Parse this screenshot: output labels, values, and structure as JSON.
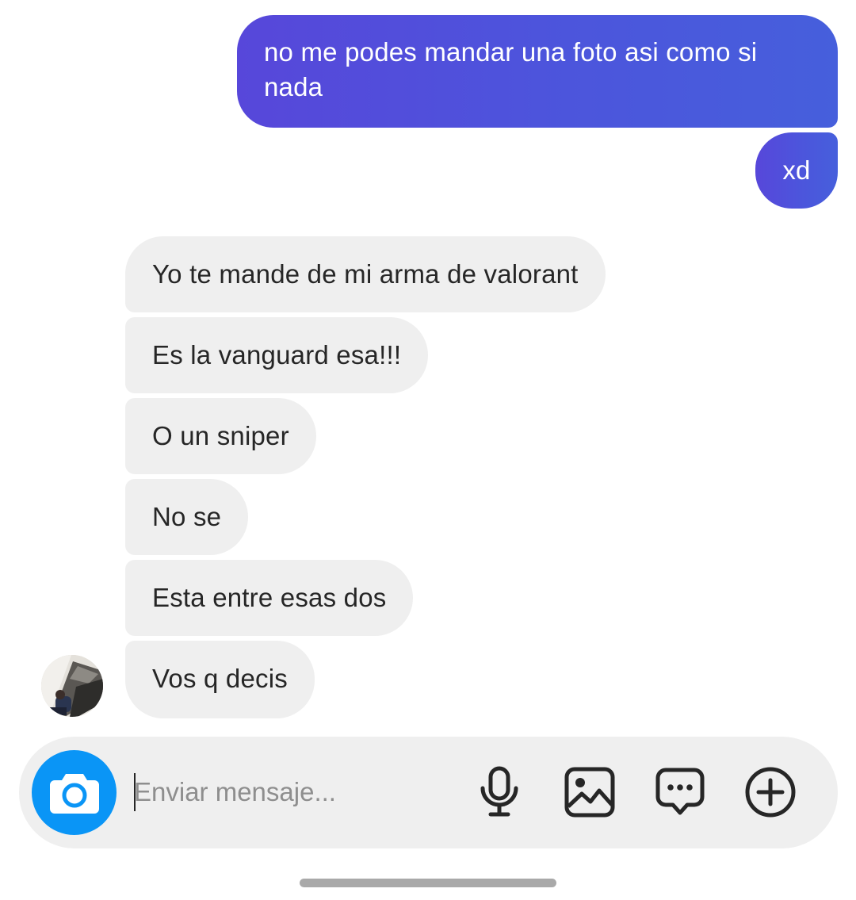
{
  "thread": {
    "outgoing": [
      {
        "text": "no me podes mandar una foto asi como si nada"
      },
      {
        "text": "xd"
      }
    ],
    "incoming": [
      {
        "text": "Yo te mande de mi arma de valorant"
      },
      {
        "text": "Es la vanguard esa!!!"
      },
      {
        "text": "O un sniper"
      },
      {
        "text": "No se"
      },
      {
        "text": "Esta entre esas dos"
      },
      {
        "text": "Vos q decis"
      }
    ]
  },
  "composer": {
    "placeholder": "Enviar mensaje...",
    "value": "",
    "icons": [
      "camera-icon",
      "microphone-icon",
      "gallery-icon",
      "sticker-icon",
      "plus-icon"
    ]
  },
  "colors": {
    "outgoing_start": "#5747DA",
    "outgoing_end": "#465FDC",
    "incoming_bubble": "#EFEFEF",
    "camera_button": "#0A95F6",
    "composer_bg": "#EFEFEF"
  }
}
